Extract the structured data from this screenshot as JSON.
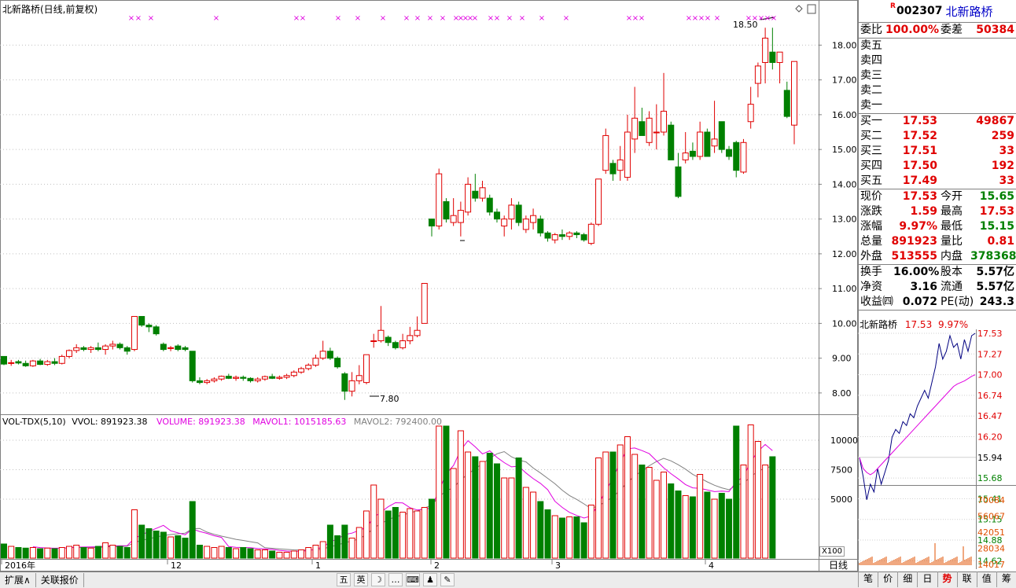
{
  "chart_title": "北新路桥(日线,前复权)",
  "volume_header": {
    "prefix": "VOL-TDX(5,10)",
    "vvol": "VVOL: 891923.38",
    "volume": "VOLUME: 891923.38",
    "mavol1": "MAVOL1: 1015185.63",
    "mavol2": "MAVOL2: 792400.00"
  },
  "annotations": {
    "high": "18.50",
    "low": "7.80"
  },
  "price_axis_labels": [
    "18.00",
    "17.00",
    "16.00",
    "15.00",
    "14.00",
    "13.00",
    "12.00",
    "11.00",
    "10.00",
    "9.00",
    "8.00"
  ],
  "volume_axis_labels": [
    "10000",
    "7500",
    "5000"
  ],
  "volume_axis_multiplier": "X100",
  "period_label": "日线",
  "date_labels": [
    "2016年",
    "12",
    "1",
    "2",
    "3",
    "4"
  ],
  "colors": {
    "up": "#e00000",
    "down": "#008000",
    "ma1": "#e000e0",
    "ma2": "#808080",
    "grid": "#c0c0c0",
    "intraday_price": "#000080",
    "intraday_avg": "#e000e0"
  },
  "chart_data": {
    "type": "candlestick",
    "price_range": [
      7.5,
      18.8
    ],
    "volume_range": [
      0,
      11000
    ],
    "candles": [
      {
        "o": 9.05,
        "h": 9.05,
        "l": 8.8,
        "c": 8.83
      },
      {
        "o": 8.85,
        "h": 8.95,
        "l": 8.78,
        "c": 8.87
      },
      {
        "o": 8.9,
        "h": 8.95,
        "l": 8.82,
        "c": 8.86
      },
      {
        "o": 8.85,
        "h": 8.93,
        "l": 8.75,
        "c": 8.78
      },
      {
        "o": 8.78,
        "h": 8.95,
        "l": 8.75,
        "c": 8.92
      },
      {
        "o": 8.92,
        "h": 8.98,
        "l": 8.8,
        "c": 8.82
      },
      {
        "o": 8.82,
        "h": 8.95,
        "l": 8.78,
        "c": 8.9
      },
      {
        "o": 8.9,
        "h": 9.0,
        "l": 8.8,
        "c": 8.85
      },
      {
        "o": 8.85,
        "h": 9.1,
        "l": 8.82,
        "c": 9.05
      },
      {
        "o": 9.05,
        "h": 9.25,
        "l": 9.0,
        "c": 9.22
      },
      {
        "o": 9.22,
        "h": 9.4,
        "l": 9.15,
        "c": 9.3
      },
      {
        "o": 9.3,
        "h": 9.35,
        "l": 9.2,
        "c": 9.25
      },
      {
        "o": 9.25,
        "h": 9.35,
        "l": 9.15,
        "c": 9.3
      },
      {
        "o": 9.3,
        "h": 9.45,
        "l": 9.2,
        "c": 9.25
      },
      {
        "o": 9.25,
        "h": 9.4,
        "l": 9.1,
        "c": 9.35
      },
      {
        "o": 9.35,
        "h": 9.5,
        "l": 9.25,
        "c": 9.4
      },
      {
        "o": 9.4,
        "h": 9.45,
        "l": 9.25,
        "c": 9.3
      },
      {
        "o": 9.3,
        "h": 9.35,
        "l": 9.1,
        "c": 9.2
      },
      {
        "o": 9.25,
        "h": 10.2,
        "l": 9.2,
        "c": 10.2
      },
      {
        "o": 10.2,
        "h": 10.2,
        "l": 9.9,
        "c": 9.95
      },
      {
        "o": 9.95,
        "h": 10.0,
        "l": 9.75,
        "c": 9.9
      },
      {
        "o": 9.9,
        "h": 9.95,
        "l": 9.65,
        "c": 9.7
      },
      {
        "o": 9.4,
        "h": 9.45,
        "l": 9.2,
        "c": 9.25
      },
      {
        "o": 9.3,
        "h": 9.35,
        "l": 9.2,
        "c": 9.3
      },
      {
        "o": 9.35,
        "h": 9.4,
        "l": 9.2,
        "c": 9.25
      },
      {
        "o": 9.3,
        "h": 9.35,
        "l": 9.2,
        "c": 9.25
      },
      {
        "o": 9.2,
        "h": 9.2,
        "l": 8.3,
        "c": 8.35
      },
      {
        "o": 8.35,
        "h": 8.45,
        "l": 8.25,
        "c": 8.3
      },
      {
        "o": 8.3,
        "h": 8.4,
        "l": 8.25,
        "c": 8.35
      },
      {
        "o": 8.35,
        "h": 8.45,
        "l": 8.3,
        "c": 8.4
      },
      {
        "o": 8.4,
        "h": 8.5,
        "l": 8.35,
        "c": 8.48
      },
      {
        "o": 8.48,
        "h": 8.55,
        "l": 8.4,
        "c": 8.42
      },
      {
        "o": 8.42,
        "h": 8.5,
        "l": 8.35,
        "c": 8.45
      },
      {
        "o": 8.45,
        "h": 8.5,
        "l": 8.35,
        "c": 8.42
      },
      {
        "o": 8.42,
        "h": 8.45,
        "l": 8.3,
        "c": 8.35
      },
      {
        "o": 8.35,
        "h": 8.45,
        "l": 8.3,
        "c": 8.4
      },
      {
        "o": 8.4,
        "h": 8.5,
        "l": 8.35,
        "c": 8.47
      },
      {
        "o": 8.47,
        "h": 8.55,
        "l": 8.4,
        "c": 8.42
      },
      {
        "o": 8.42,
        "h": 8.5,
        "l": 8.38,
        "c": 8.45
      },
      {
        "o": 8.45,
        "h": 8.55,
        "l": 8.4,
        "c": 8.5
      },
      {
        "o": 8.5,
        "h": 8.65,
        "l": 8.45,
        "c": 8.6
      },
      {
        "o": 8.6,
        "h": 8.75,
        "l": 8.55,
        "c": 8.7
      },
      {
        "o": 8.7,
        "h": 8.85,
        "l": 8.65,
        "c": 8.8
      },
      {
        "o": 8.8,
        "h": 9.1,
        "l": 8.75,
        "c": 9.0
      },
      {
        "o": 9.0,
        "h": 9.5,
        "l": 8.95,
        "c": 9.2
      },
      {
        "o": 9.2,
        "h": 9.3,
        "l": 8.95,
        "c": 9.0
      },
      {
        "o": 9.0,
        "h": 9.05,
        "l": 8.7,
        "c": 8.75
      },
      {
        "o": 8.55,
        "h": 8.6,
        "l": 7.8,
        "c": 8.05
      },
      {
        "o": 8.05,
        "h": 8.6,
        "l": 7.9,
        "c": 8.35
      },
      {
        "o": 8.35,
        "h": 8.8,
        "l": 8.25,
        "c": 8.5
      },
      {
        "o": 8.3,
        "h": 9.1,
        "l": 8.25,
        "c": 9.1
      },
      {
        "o": 9.5,
        "h": 9.7,
        "l": 9.3,
        "c": 9.5
      },
      {
        "o": 9.5,
        "h": 10.5,
        "l": 9.45,
        "c": 9.8
      },
      {
        "o": 9.6,
        "h": 9.65,
        "l": 9.35,
        "c": 9.45
      },
      {
        "o": 9.45,
        "h": 9.5,
        "l": 9.25,
        "c": 9.3
      },
      {
        "o": 9.3,
        "h": 9.7,
        "l": 9.25,
        "c": 9.5
      },
      {
        "o": 9.5,
        "h": 9.9,
        "l": 9.4,
        "c": 9.65
      },
      {
        "o": 9.65,
        "h": 10.2,
        "l": 9.6,
        "c": 9.8
      },
      {
        "o": 10.0,
        "h": 11.15,
        "l": 10.0,
        "c": 11.15
      },
      {
        "o": 13.0,
        "h": 13.0,
        "l": 12.5,
        "c": 12.8
      },
      {
        "o": 12.8,
        "h": 14.45,
        "l": 12.7,
        "c": 14.3
      },
      {
        "o": 13.5,
        "h": 13.6,
        "l": 12.9,
        "c": 13.0
      },
      {
        "o": 12.9,
        "h": 13.6,
        "l": 12.8,
        "c": 13.1
      },
      {
        "o": 12.9,
        "h": 13.5,
        "l": 12.5,
        "c": 13.25
      },
      {
        "o": 13.2,
        "h": 14.2,
        "l": 13.1,
        "c": 14.0
      },
      {
        "o": 13.8,
        "h": 14.3,
        "l": 13.5,
        "c": 13.6
      },
      {
        "o": 13.6,
        "h": 14.1,
        "l": 13.5,
        "c": 13.9
      },
      {
        "o": 13.6,
        "h": 13.7,
        "l": 13.1,
        "c": 13.2
      },
      {
        "o": 13.2,
        "h": 13.3,
        "l": 12.9,
        "c": 13.0
      },
      {
        "o": 12.8,
        "h": 13.1,
        "l": 12.5,
        "c": 13.0
      },
      {
        "o": 13.0,
        "h": 13.6,
        "l": 12.7,
        "c": 13.4
      },
      {
        "o": 13.4,
        "h": 13.5,
        "l": 12.8,
        "c": 12.9
      },
      {
        "o": 12.7,
        "h": 13.1,
        "l": 12.6,
        "c": 13.0
      },
      {
        "o": 12.9,
        "h": 13.3,
        "l": 12.7,
        "c": 13.1
      },
      {
        "o": 13.0,
        "h": 13.1,
        "l": 12.5,
        "c": 12.6
      },
      {
        "o": 12.6,
        "h": 12.65,
        "l": 12.35,
        "c": 12.45
      },
      {
        "o": 12.4,
        "h": 12.6,
        "l": 12.3,
        "c": 12.55
      },
      {
        "o": 12.55,
        "h": 12.7,
        "l": 12.4,
        "c": 12.5
      },
      {
        "o": 12.5,
        "h": 12.65,
        "l": 12.4,
        "c": 12.6
      },
      {
        "o": 12.6,
        "h": 12.65,
        "l": 12.45,
        "c": 12.55
      },
      {
        "o": 12.55,
        "h": 12.6,
        "l": 12.35,
        "c": 12.4
      },
      {
        "o": 12.3,
        "h": 12.9,
        "l": 12.25,
        "c": 12.85
      },
      {
        "o": 12.85,
        "h": 14.15,
        "l": 12.8,
        "c": 14.15
      },
      {
        "o": 14.4,
        "h": 15.6,
        "l": 14.3,
        "c": 15.4
      },
      {
        "o": 14.6,
        "h": 14.7,
        "l": 14.1,
        "c": 14.3
      },
      {
        "o": 14.4,
        "h": 15.1,
        "l": 14.1,
        "c": 14.7
      },
      {
        "o": 14.2,
        "h": 16.0,
        "l": 14.1,
        "c": 15.5
      },
      {
        "o": 15.3,
        "h": 16.8,
        "l": 14.9,
        "c": 15.9
      },
      {
        "o": 15.8,
        "h": 16.2,
        "l": 15.4,
        "c": 15.4
      },
      {
        "o": 15.2,
        "h": 16.1,
        "l": 15.1,
        "c": 15.9
      },
      {
        "o": 15.5,
        "h": 16.3,
        "l": 15.0,
        "c": 15.5
      },
      {
        "o": 15.5,
        "h": 17.2,
        "l": 15.4,
        "c": 16.1
      },
      {
        "o": 15.7,
        "h": 15.8,
        "l": 14.7,
        "c": 14.7
      },
      {
        "o": 14.5,
        "h": 14.9,
        "l": 13.6,
        "c": 13.65
      },
      {
        "o": 14.7,
        "h": 15.5,
        "l": 14.6,
        "c": 14.9
      },
      {
        "o": 14.95,
        "h": 15.2,
        "l": 14.7,
        "c": 14.8
      },
      {
        "o": 14.8,
        "h": 15.8,
        "l": 14.7,
        "c": 15.5
      },
      {
        "o": 15.5,
        "h": 15.6,
        "l": 14.8,
        "c": 14.8
      },
      {
        "o": 15.1,
        "h": 16.4,
        "l": 14.9,
        "c": 15.3
      },
      {
        "o": 15.8,
        "h": 15.8,
        "l": 14.9,
        "c": 15.0
      },
      {
        "o": 15.0,
        "h": 15.1,
        "l": 14.7,
        "c": 14.8
      },
      {
        "o": 15.2,
        "h": 15.25,
        "l": 14.2,
        "c": 14.4
      },
      {
        "o": 14.35,
        "h": 15.3,
        "l": 14.3,
        "c": 15.2
      },
      {
        "o": 15.8,
        "h": 16.8,
        "l": 15.6,
        "c": 16.3
      },
      {
        "o": 16.9,
        "h": 17.5,
        "l": 16.5,
        "c": 17.4
      },
      {
        "o": 17.5,
        "h": 18.5,
        "l": 16.9,
        "c": 18.2
      },
      {
        "o": 17.8,
        "h": 18.5,
        "l": 17.3,
        "c": 17.5
      },
      {
        "o": 17.5,
        "h": 17.8,
        "l": 16.9,
        "c": 17.8
      },
      {
        "o": 16.7,
        "h": 16.95,
        "l": 15.9,
        "c": 15.95
      },
      {
        "o": 15.7,
        "h": 17.53,
        "l": 15.15,
        "c": 17.53
      }
    ],
    "volume": [
      1200,
      1000,
      900,
      850,
      900,
      800,
      850,
      800,
      900,
      1000,
      1100,
      900,
      850,
      1000,
      1300,
      1100,
      1000,
      900,
      4100,
      2800,
      2500,
      2300,
      2200,
      1800,
      1900,
      1700,
      4800,
      1100,
      1000,
      900,
      1000,
      900,
      800,
      900,
      800,
      700,
      700,
      600,
      500,
      500,
      600,
      700,
      900,
      1100,
      1400,
      2800,
      1900,
      2800,
      1700,
      2600,
      4000,
      6200,
      5000,
      4000,
      4300,
      3900,
      4200,
      4000,
      4300,
      5000,
      11200,
      11200,
      7600,
      10800,
      9000,
      8600,
      8200,
      8900,
      8000,
      6800,
      6800,
      8500,
      6000,
      5600,
      4800,
      4100,
      3600,
      3400,
      3500,
      3500,
      3000,
      4500,
      8500,
      9000,
      9000,
      9600,
      10300,
      8800,
      7900,
      7700,
      6600,
      7300,
      6300,
      5700,
      5300,
      5200,
      7100,
      5600,
      5000,
      5500,
      5000,
      11200,
      7900,
      11300,
      9900,
      7900,
      8600
    ],
    "ma5_volume": [
      900,
      1250,
      1000,
      2200,
      1800,
      5400,
      11800,
      2000,
      10400
    ],
    "ma10_volume": [
      900,
      950,
      1000,
      3400,
      6800,
      8800,
      6200,
      3800,
      10000
    ]
  },
  "signal_marks": "×",
  "quote": {
    "flag": "R",
    "code": "002307",
    "name": "北新路桥",
    "weibi_label": "委比",
    "weibi": "100.00%",
    "weicha_label": "委差",
    "weicha": "50384",
    "asks": [
      {
        "label": "卖五"
      },
      {
        "label": "卖四"
      },
      {
        "label": "卖三"
      },
      {
        "label": "卖二"
      },
      {
        "label": "卖一"
      }
    ],
    "bids": [
      {
        "label": "买一",
        "price": "17.53",
        "vol": "49867"
      },
      {
        "label": "买二",
        "price": "17.52",
        "vol": "259"
      },
      {
        "label": "买三",
        "price": "17.51",
        "vol": "33"
      },
      {
        "label": "买四",
        "price": "17.50",
        "vol": "192"
      },
      {
        "label": "买五",
        "price": "17.49",
        "vol": "33"
      }
    ],
    "stats1": [
      {
        "l1": "现价",
        "v1": "17.53",
        "l2": "今开",
        "v2": "15.65"
      },
      {
        "l1": "涨跌",
        "v1": "1.59",
        "l2": "最高",
        "v2": "17.53"
      },
      {
        "l1": "涨幅",
        "v1": "9.97%",
        "l2": "最低",
        "v2": "15.15"
      },
      {
        "l1": "总量",
        "v1": "891923",
        "l2": "量比",
        "v2": "0.81"
      },
      {
        "l1": "外盘",
        "v1": "513555",
        "l2": "内盘",
        "v2": "378368"
      }
    ],
    "stats2": [
      {
        "l1": "换手",
        "v1": "16.00%",
        "l2": "股本",
        "v2": "5.57亿"
      },
      {
        "l1": "净资",
        "v1": "3.16",
        "l2": "流通",
        "v2": "5.57亿"
      },
      {
        "l1": "收益㈣",
        "v1": "0.072",
        "l2": "PE(动)",
        "v2": "243.3"
      }
    ]
  },
  "intraday": {
    "title": "北新路桥",
    "price": "17.53",
    "pct": "9.97%",
    "price_labels": [
      "17.53",
      "17.27",
      "17.00",
      "16.74",
      "16.47",
      "16.20",
      "15.94",
      "15.68",
      "15.41",
      "15.15",
      "14.88",
      "14.62"
    ],
    "vol_labels": [
      "70084",
      "56067",
      "42051",
      "28034",
      "14017"
    ]
  },
  "bottom": {
    "tab1": "扩展∧",
    "tab2": "关联报价",
    "tools": [
      "五",
      "英",
      "☽",
      "…",
      "⌨",
      "♟",
      "✎"
    ],
    "nav": [
      "笔",
      "价",
      "细",
      "日",
      "势",
      "联",
      "值",
      "筹"
    ],
    "nav_active": 4
  }
}
